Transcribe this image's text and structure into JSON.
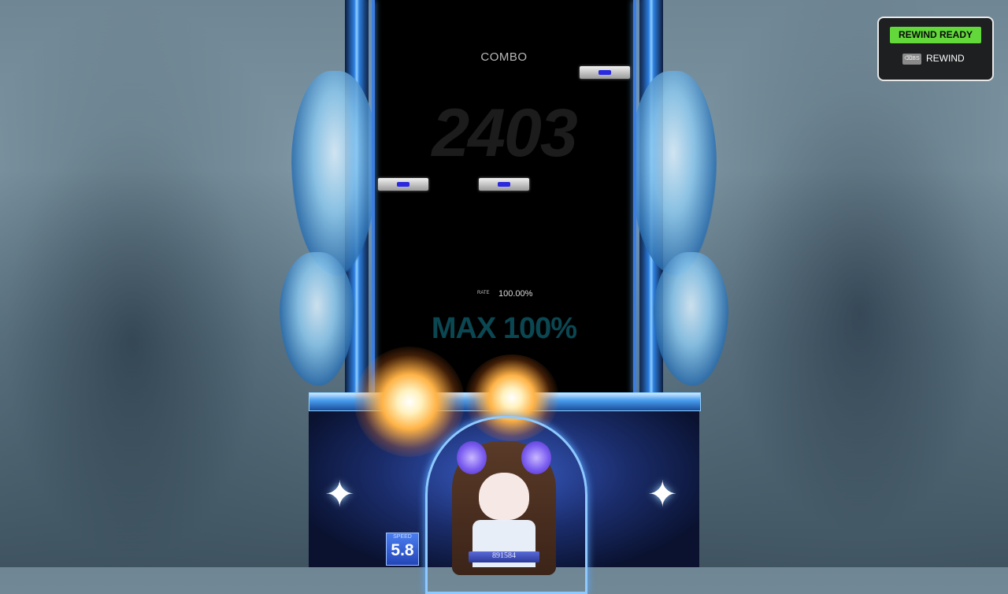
{
  "playfield": {
    "combo_label": "COMBO",
    "combo_value": "2403",
    "rate_label": "RATE",
    "rate_value": "100.00%",
    "max_text": "MAX 100%"
  },
  "hud": {
    "speed_label": "SPEED",
    "speed_value": "5.8",
    "score_value": "891584"
  },
  "rewind": {
    "ready_label": "REWIND READY",
    "key_label": "⌫BS",
    "action_label": "REWIND"
  },
  "colors": {
    "rewind_ready": "#62d83a",
    "lane_edge": "#3e7de0",
    "note_marker": "#2a28e0"
  }
}
